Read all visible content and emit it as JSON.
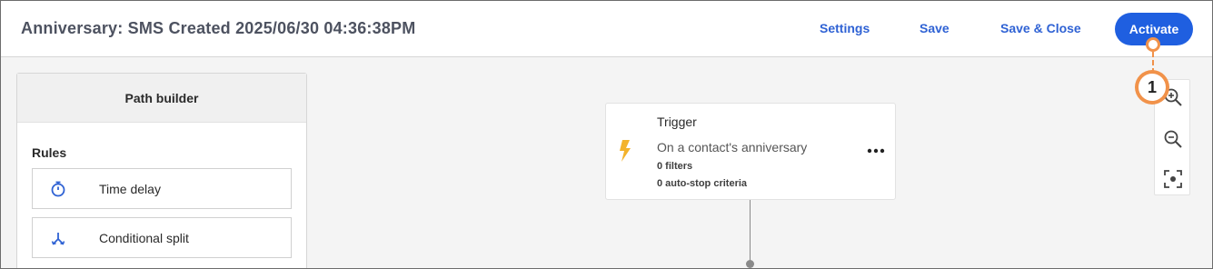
{
  "header": {
    "title": "Anniversary: SMS Created 2025/06/30 04:36:38PM",
    "settings_label": "Settings",
    "save_label": "Save",
    "save_close_label": "Save & Close",
    "activate_label": "Activate"
  },
  "path_builder": {
    "title": "Path builder",
    "rules_label": "Rules",
    "rules": [
      {
        "label": "Time delay",
        "icon": "stopwatch-icon"
      },
      {
        "label": "Conditional split",
        "icon": "split-icon"
      }
    ]
  },
  "trigger": {
    "title": "Trigger",
    "description": "On a contact's anniversary",
    "filters": "0 filters",
    "auto_stop": "0 auto-stop criteria",
    "icon": "lightning-icon"
  },
  "zoom_controls": [
    "zoom-in-icon",
    "zoom-out-icon",
    "fit-to-screen-icon"
  ],
  "callout": {
    "number": "1"
  },
  "colors": {
    "accent": "#1f5fe0",
    "link": "#2f62d4",
    "callout": "#f1924a",
    "bolt": "#f3b32c"
  }
}
